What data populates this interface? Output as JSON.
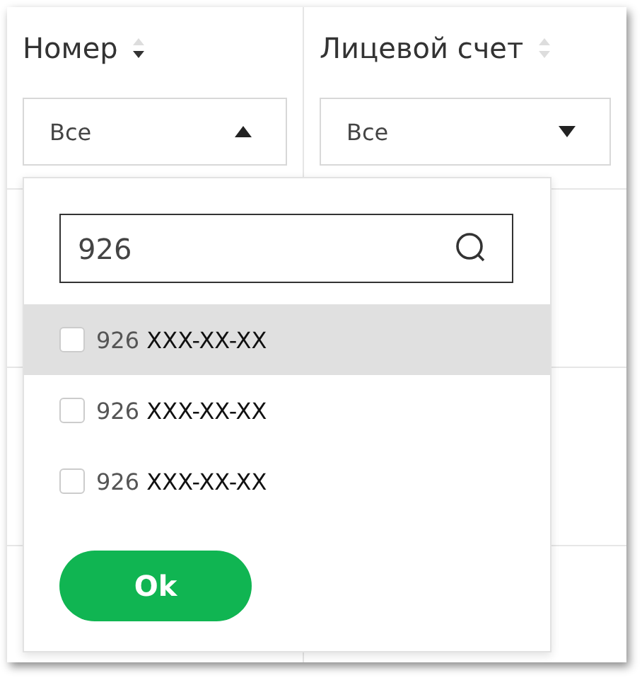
{
  "columns": [
    {
      "title": "Номер",
      "sorted": true,
      "filter": {
        "value": "Все",
        "expanded": true
      }
    },
    {
      "title": "Лицевой счет",
      "sorted": false,
      "filter": {
        "value": "Все",
        "expanded": false
      }
    }
  ],
  "dropdown": {
    "search": {
      "value": "926"
    },
    "options": [
      {
        "match": "926",
        "rest": "XXX-XX-XX",
        "checked": false,
        "highlighted": true
      },
      {
        "match": "926",
        "rest": "XXX-XX-XX",
        "checked": false,
        "highlighted": false
      },
      {
        "match": "926",
        "rest": "XXX-XX-XX",
        "checked": false,
        "highlighted": false
      }
    ],
    "button": "Ok"
  }
}
